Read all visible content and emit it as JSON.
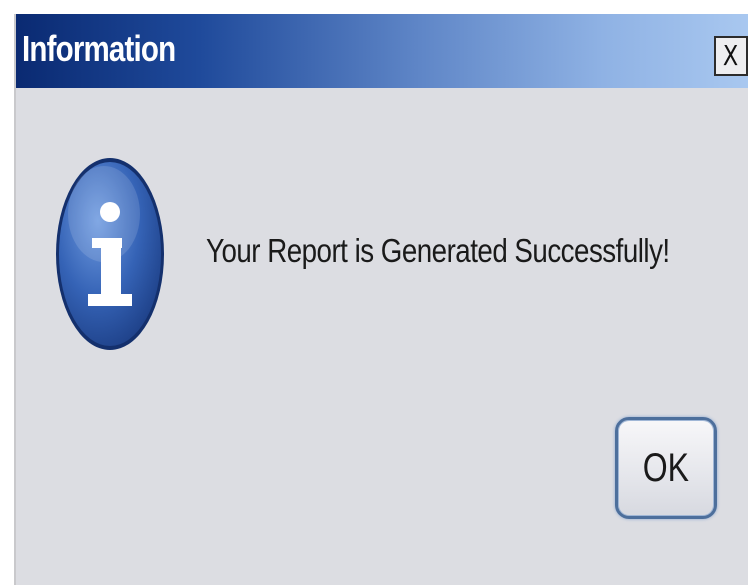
{
  "dialog": {
    "title": "Information",
    "close_label": "X",
    "icon": "info-icon",
    "message": "Your Report is Generated Successfully!",
    "ok_label": "OK"
  },
  "colors": {
    "titlebar_start": "#0a2a72",
    "titlebar_end": "#a9c8f0",
    "dialog_background": "#dcdde2",
    "icon_blue": "#2a57a8",
    "button_border": "#4d6f9c"
  }
}
